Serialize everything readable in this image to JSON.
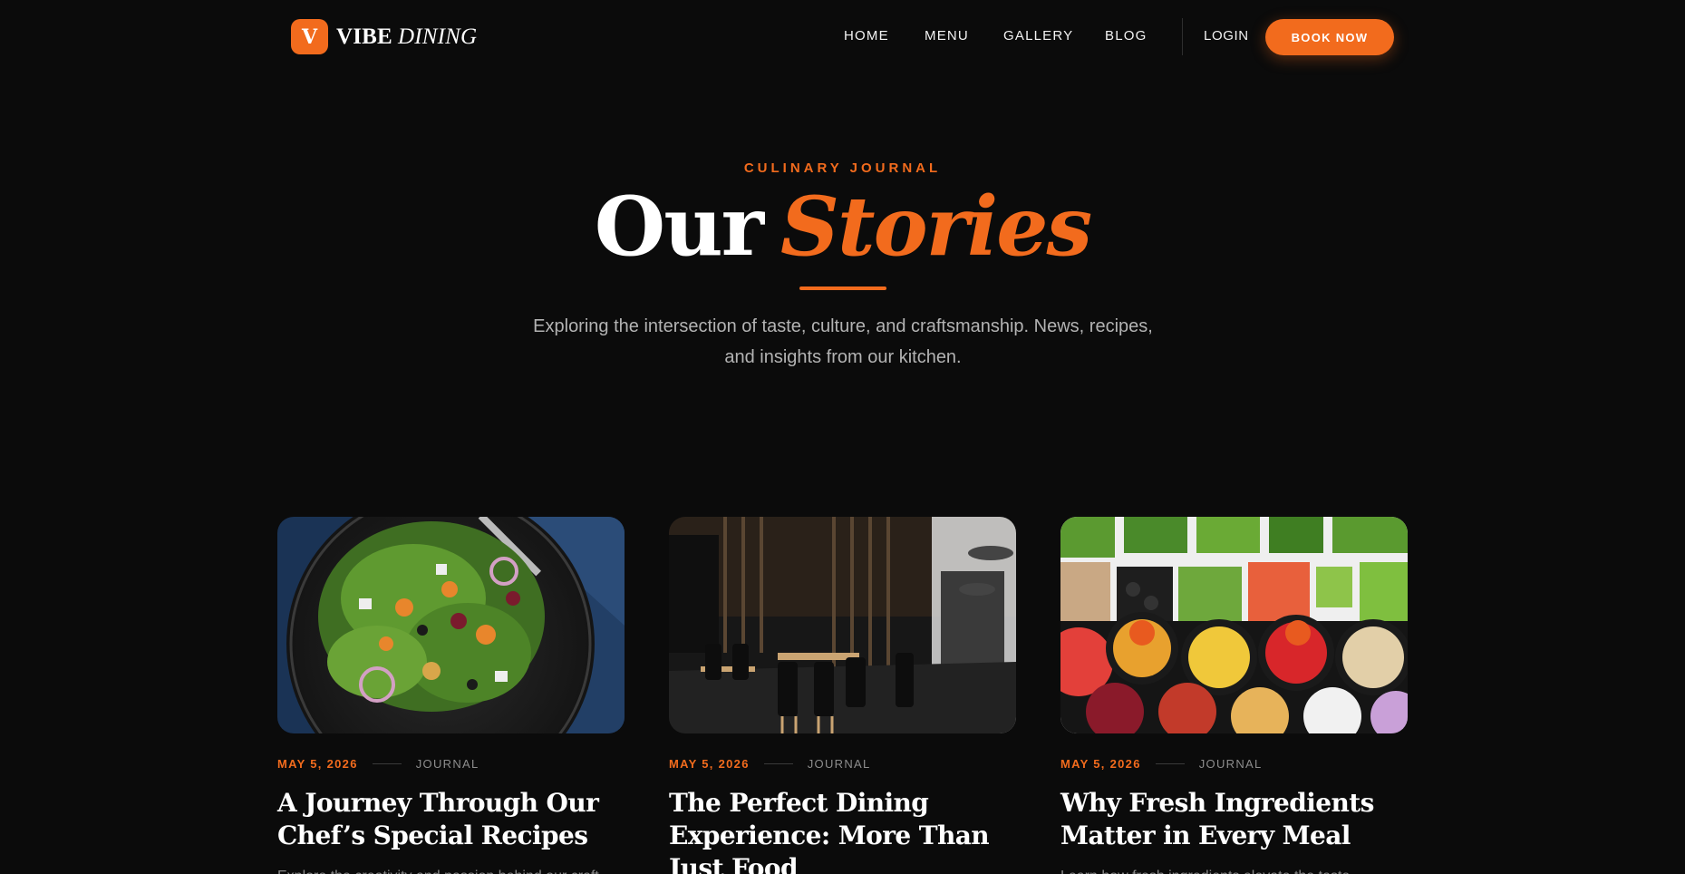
{
  "brand": {
    "mark": "V",
    "name_bold": "VIBE",
    "name_italic": "DINING"
  },
  "nav": {
    "items": [
      {
        "label": "HOME"
      },
      {
        "label": "MENU"
      },
      {
        "label": "GALLERY"
      },
      {
        "label": "BLOG"
      }
    ],
    "login": "LOGIN",
    "cta": "BOOK NOW"
  },
  "hero": {
    "eyebrow": "CULINARY JOURNAL",
    "title_plain": "Our",
    "title_accent": "Stories",
    "subtitle": "Exploring the intersection of taste, culture, and craftsmanship. News, recipes, and insights from our kitchen."
  },
  "posts": [
    {
      "date": "MAY 5, 2026",
      "category": "JOURNAL",
      "title": "A Journey Through Our Chef’s Special Recipes",
      "excerpt": "Explore the creativity and passion behind our craft",
      "image": "salad-plate"
    },
    {
      "date": "MAY 5, 2026",
      "category": "JOURNAL",
      "title": "The Perfect Dining Experience: More Than Just Food",
      "excerpt": "",
      "image": "restaurant-interior"
    },
    {
      "date": "MAY 5, 2026",
      "category": "JOURNAL",
      "title": "Why Fresh Ingredients Matter in Every Meal",
      "excerpt": "Learn how fresh ingredients elevate the taste",
      "image": "ingredient-bowls"
    }
  ],
  "colors": {
    "accent": "#f26b1d",
    "background": "#0b0b0b"
  }
}
